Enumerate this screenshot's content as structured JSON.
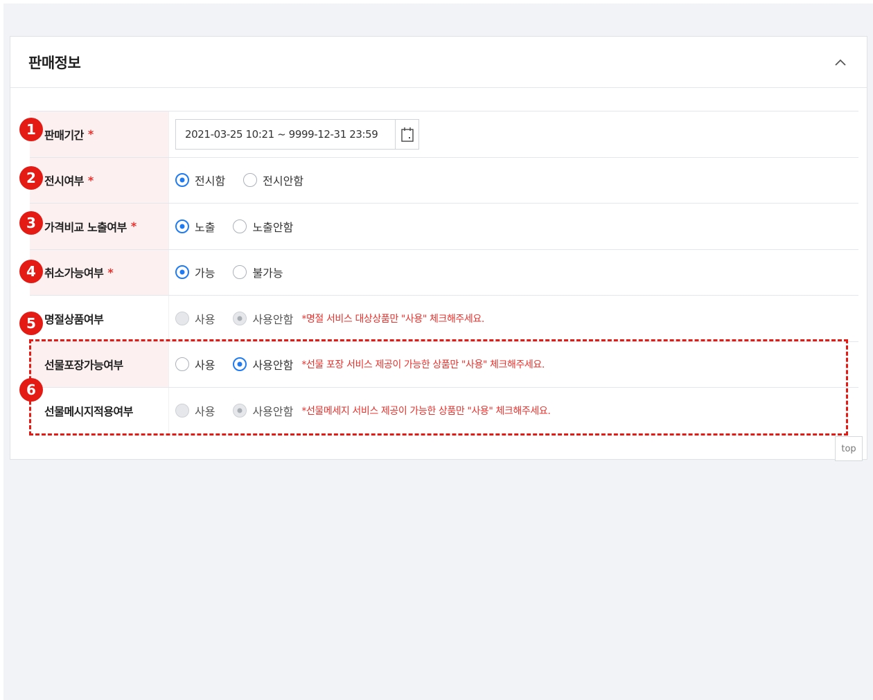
{
  "section": {
    "title": "판매정보",
    "collapse_icon": "chevron-up-icon"
  },
  "rows": {
    "sale_period": {
      "label": "판매기간",
      "required_mark": "*",
      "value": "2021-03-25 10:21 ~ 9999-12-31 23:59",
      "icon": "calendar-icon"
    },
    "display": {
      "label": "전시여부",
      "required_mark": "*",
      "options": [
        "전시함",
        "전시안함"
      ],
      "selected": "전시함"
    },
    "price_compare": {
      "label": "가격비교 노출여부",
      "required_mark": "*",
      "options": [
        "노출",
        "노출안함"
      ],
      "selected": "노출"
    },
    "cancelable": {
      "label": "취소가능여부",
      "required_mark": "*",
      "options": [
        "가능",
        "불가능"
      ],
      "selected": "가능"
    },
    "holiday_product": {
      "label": "명절상품여부",
      "options": [
        "사용",
        "사용안함"
      ],
      "selected": "사용안함",
      "disabled": true,
      "note": "*명절 서비스 대상상품만 \"사용\" 체크해주세요."
    },
    "gift_wrap": {
      "label": "선물포장가능여부",
      "options": [
        "사용",
        "사용안함"
      ],
      "selected": "사용안함",
      "note": "*선물 포장 서비스 제공이 가능한 상품만 \"사용\" 체크해주세요."
    },
    "gift_message": {
      "label": "선물메시지적용여부",
      "options": [
        "사용",
        "사용안함"
      ],
      "selected": "사용안함",
      "disabled": true,
      "note": "*선물메세지 서비스 제공이 가능한 상품만 \"사용\" 체크해주세요."
    }
  },
  "annotations": [
    "1",
    "2",
    "3",
    "4",
    "5",
    "6"
  ],
  "top_button": "top",
  "colors": {
    "accent": "#1f7bf2",
    "required": "#e6322d",
    "annotation": "#e31b14",
    "label_bg": "#fdf0f0",
    "page_bg": "#f1f3f6"
  }
}
